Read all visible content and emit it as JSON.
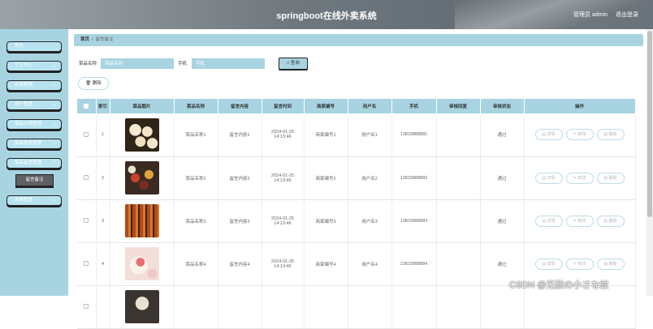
{
  "header": {
    "title": "springboot在线外卖系统",
    "user": "管理员 admin",
    "logout": "退出登录"
  },
  "sidebar": {
    "items": [
      {
        "label": "首页",
        "chevron": false
      },
      {
        "label": "个人中心",
        "chevron": true
      },
      {
        "label": "商家管理",
        "chevron": true
      },
      {
        "label": "用户管理",
        "chevron": true
      },
      {
        "label": "菜品分类管理",
        "chevron": true
      },
      {
        "label": "菜品信息管理",
        "chevron": true
      },
      {
        "label": "菜品留言管理",
        "chevron": true
      },
      {
        "label": "系统管理",
        "chevron": true
      }
    ],
    "sub_item": "留言备注"
  },
  "breadcrumb": {
    "home": "首页",
    "sep": "/",
    "current": "留言备注"
  },
  "search": {
    "name_label": "菜品名称",
    "name_placeholder": "菜品名称",
    "phone_label": "手机",
    "phone_placeholder": "手机",
    "query_button": "查询"
  },
  "delete_button": "删除",
  "table": {
    "headers": [
      "索引",
      "菜品图片",
      "菜品名称",
      "留言内容",
      "留言时间",
      "商家编号",
      "用户名",
      "手机",
      "审核回复",
      "审核状态",
      "操作"
    ],
    "rows": [
      {
        "index": "1",
        "img": "f1",
        "name": "菜品名称1",
        "content": "留言内容1",
        "time": "2024-01-25 14:13:46",
        "shop": "商家编号1",
        "user": "用户名1",
        "phone": "13823888881",
        "reply": "",
        "status": "通过"
      },
      {
        "index": "2",
        "img": "f2",
        "name": "菜品名称2",
        "content": "留言内容2",
        "time": "2024-01-25 14:13:46",
        "shop": "商家编号2",
        "user": "用户名2",
        "phone": "13823888882",
        "reply": "",
        "status": "通过"
      },
      {
        "index": "3",
        "img": "f3",
        "name": "菜品名称3",
        "content": "留言内容3",
        "time": "2024-01-25 14:13:46",
        "shop": "商家编号3",
        "user": "用户名3",
        "phone": "13823888883",
        "reply": "",
        "status": "通过"
      },
      {
        "index": "4",
        "img": "f4",
        "name": "菜品名称4",
        "content": "留言内容4",
        "time": "2024-01-25 14:13:46",
        "shop": "商家编号4",
        "user": "用户名4",
        "phone": "13823888884",
        "reply": "",
        "status": "通过"
      },
      {
        "index": "",
        "img": "f5",
        "name": "",
        "content": "",
        "time": "",
        "shop": "",
        "user": "",
        "phone": "",
        "reply": "",
        "status": ""
      }
    ],
    "ops": {
      "detail": "详情",
      "edit": "修改",
      "delete": "删除"
    }
  },
  "watermark": "CSDN @无敌の小さな蚊"
}
